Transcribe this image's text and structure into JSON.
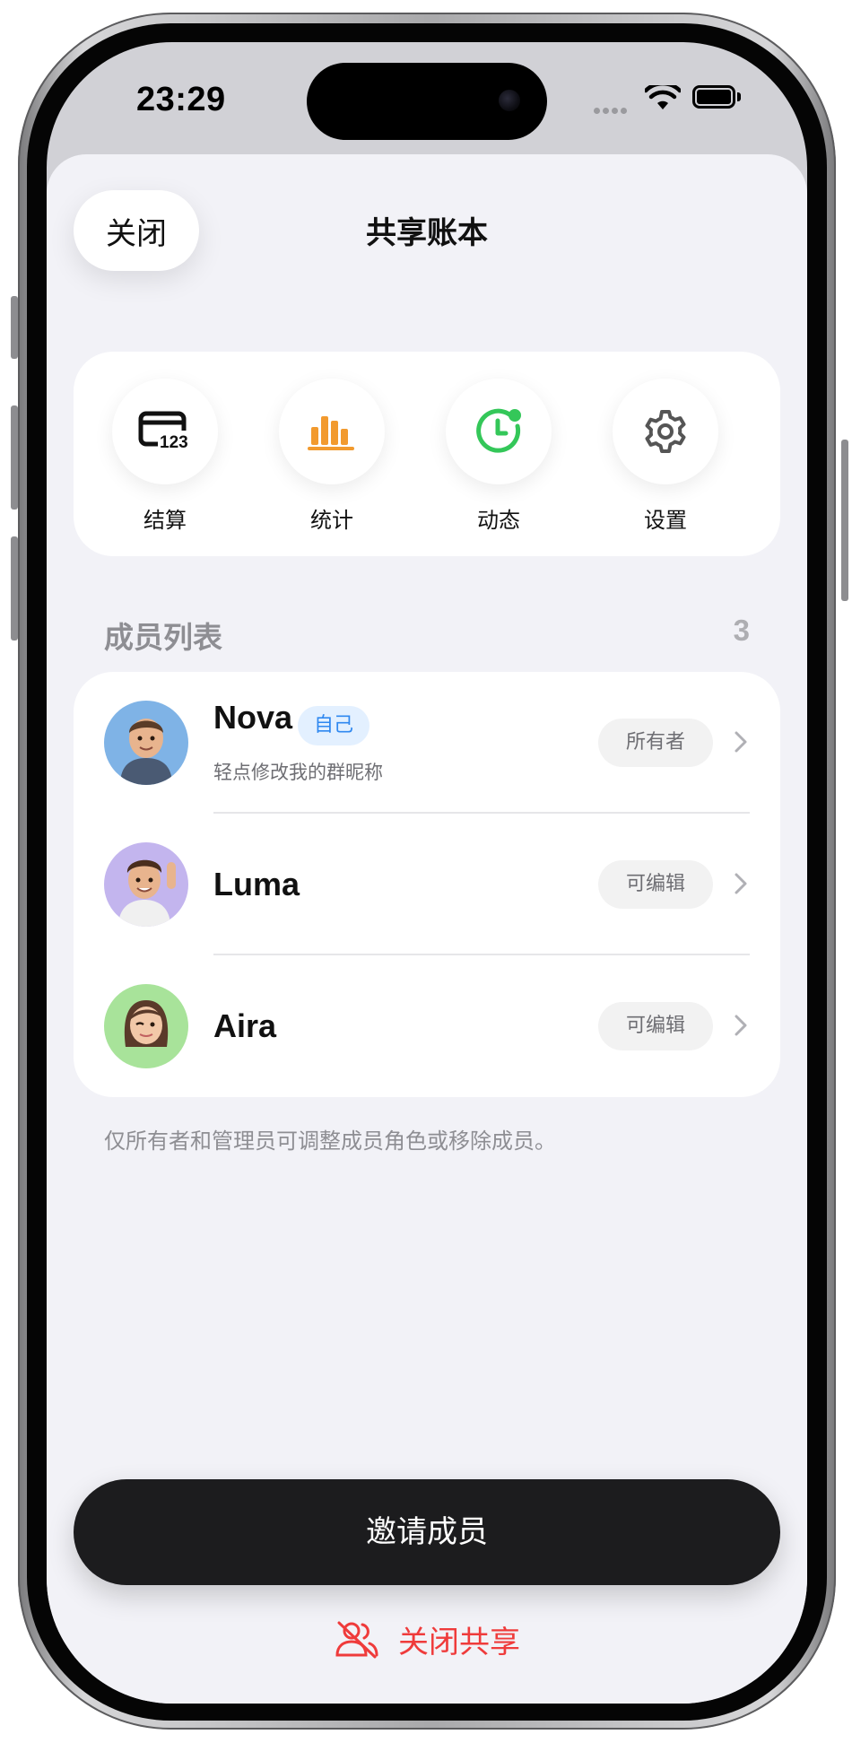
{
  "status_bar": {
    "time": "23:29"
  },
  "header": {
    "close_label": "关闭",
    "title": "共享账本"
  },
  "actions": [
    {
      "label": "结算",
      "icon": "card-123-icon",
      "color": "#111111"
    },
    {
      "label": "统计",
      "icon": "bar-chart-icon",
      "color": "#f29a2e"
    },
    {
      "label": "动态",
      "icon": "clock-activity-icon",
      "color": "#34c759"
    },
    {
      "label": "设置",
      "icon": "gear-icon",
      "color": "#555555"
    }
  ],
  "members_section": {
    "title": "成员列表",
    "count": "3",
    "members": [
      {
        "name": "Nova",
        "self_badge": "自己",
        "subtitle": "轻点修改我的群昵称",
        "role": "所有者",
        "avatar_bg": "#7fb3e6"
      },
      {
        "name": "Luma",
        "role": "可编辑",
        "avatar_bg": "#c3b5ee"
      },
      {
        "name": "Aira",
        "role": "可编辑",
        "avatar_bg": "#a8e39a"
      }
    ],
    "footnote": "仅所有者和管理员可调整成员角色或移除成员。"
  },
  "invite_label": "邀请成员",
  "stop_share_label": "关闭共享",
  "colors": {
    "accent_blue": "#2f88f0",
    "danger_red": "#ef3b3b",
    "sheet_bg": "#f2f2f7"
  }
}
